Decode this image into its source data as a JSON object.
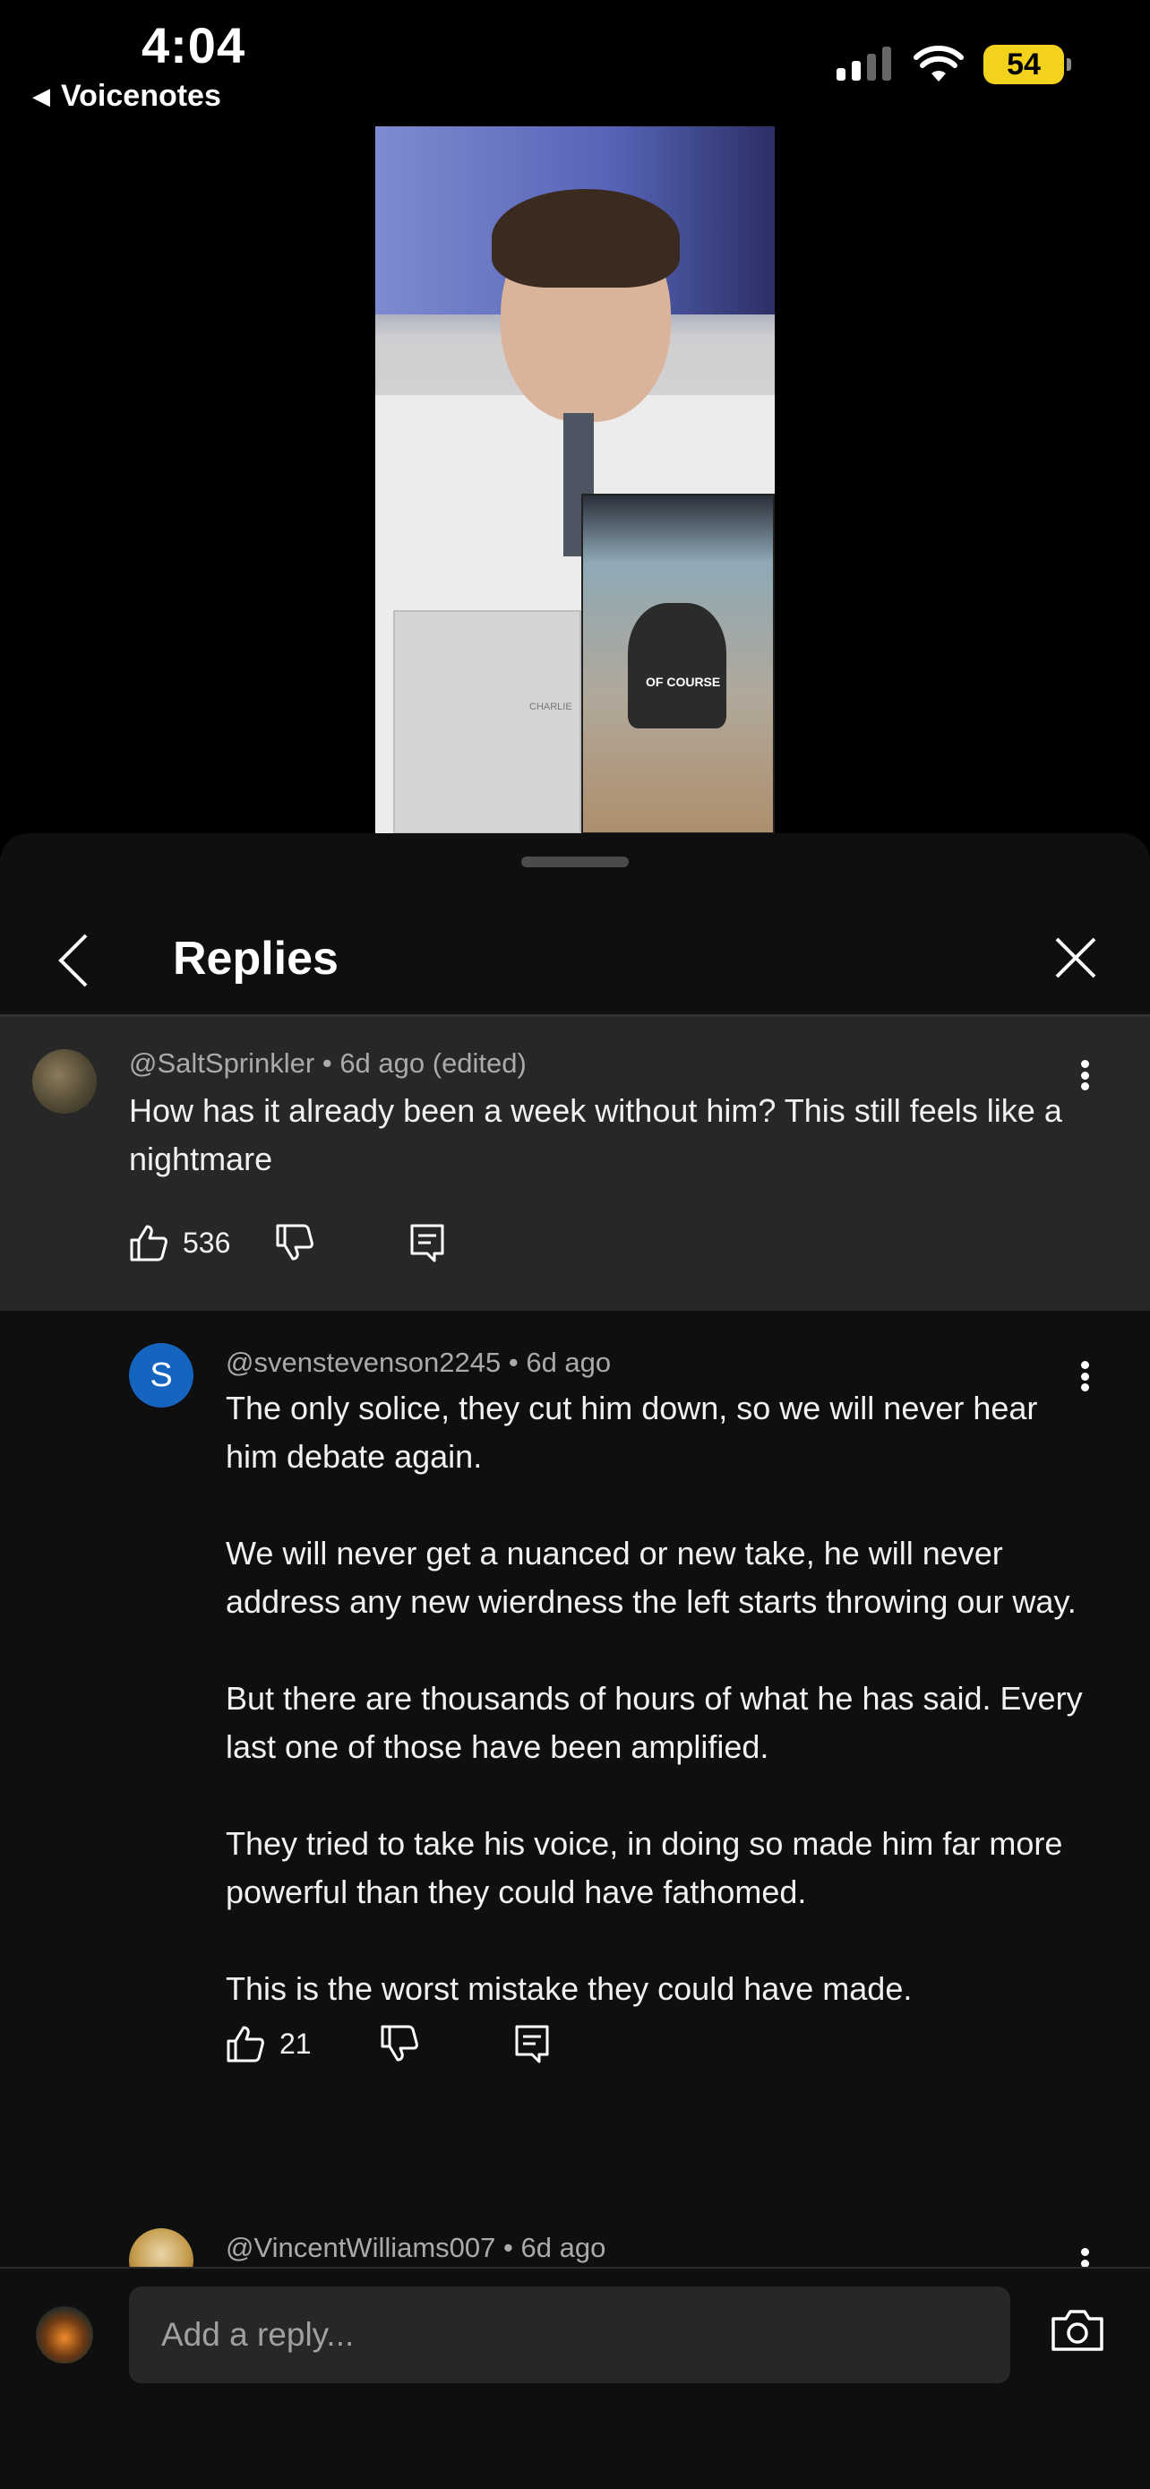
{
  "status_bar": {
    "time": "4:04",
    "back_app": "Voicenotes",
    "battery": "54"
  },
  "video": {
    "inset_caption": "OF COURSE",
    "laptop_text": "CHARLIE"
  },
  "header": {
    "title": "Replies"
  },
  "parent_comment": {
    "author": "@SaltSprinkler",
    "age": "6d ago (edited)",
    "text": "How has it already been a week without him? This still feels like a nightmare",
    "likes": "536"
  },
  "replies": [
    {
      "avatar_letter": "S",
      "author": "@svenstevenson2245",
      "age": "6d ago",
      "paragraphs": [
        "The only solice, they cut him down, so we will never hear him debate again.",
        "We will never get a nuanced or new take, he will never address any new wierdness the left starts throwing our way.",
        "But there are thousands of hours of what he has said. Every last one of those have been amplified.",
        "They tried to take his voice, in doing so made him far more powerful than they could have fathomed.",
        "This is the worst mistake they could have made."
      ],
      "likes": "21"
    },
    {
      "author": "@VincentWilliams007",
      "age": "6d ago"
    }
  ],
  "reply_bar": {
    "placeholder": "Add a reply..."
  },
  "colors": {
    "sheet_bg": "#0f0f0f",
    "highlight_bg": "#272727",
    "avatar_s": "#1565c0",
    "battery": "#f3d21d"
  },
  "icons": [
    "back-chevron-icon",
    "close-icon",
    "like-icon",
    "dislike-icon",
    "reply-icon",
    "more-vert-icon",
    "camera-icon",
    "signal-icon",
    "wifi-icon"
  ]
}
